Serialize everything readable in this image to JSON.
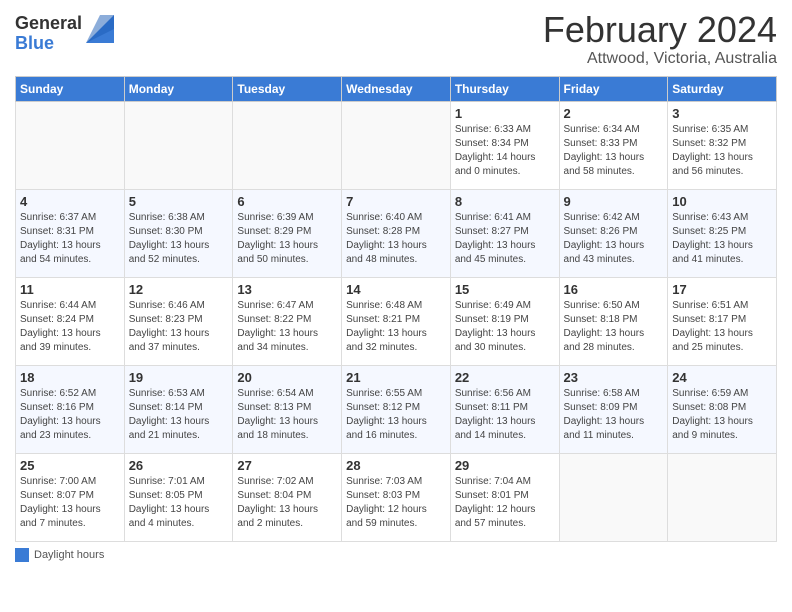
{
  "logo": {
    "general": "General",
    "blue": "Blue"
  },
  "title": "February 2024",
  "subtitle": "Attwood, Victoria, Australia",
  "days_of_week": [
    "Sunday",
    "Monday",
    "Tuesday",
    "Wednesday",
    "Thursday",
    "Friday",
    "Saturday"
  ],
  "weeks": [
    [
      {
        "day": "",
        "info": ""
      },
      {
        "day": "",
        "info": ""
      },
      {
        "day": "",
        "info": ""
      },
      {
        "day": "",
        "info": ""
      },
      {
        "day": "1",
        "info": "Sunrise: 6:33 AM\nSunset: 8:34 PM\nDaylight: 14 hours\nand 0 minutes."
      },
      {
        "day": "2",
        "info": "Sunrise: 6:34 AM\nSunset: 8:33 PM\nDaylight: 13 hours\nand 58 minutes."
      },
      {
        "day": "3",
        "info": "Sunrise: 6:35 AM\nSunset: 8:32 PM\nDaylight: 13 hours\nand 56 minutes."
      }
    ],
    [
      {
        "day": "4",
        "info": "Sunrise: 6:37 AM\nSunset: 8:31 PM\nDaylight: 13 hours\nand 54 minutes."
      },
      {
        "day": "5",
        "info": "Sunrise: 6:38 AM\nSunset: 8:30 PM\nDaylight: 13 hours\nand 52 minutes."
      },
      {
        "day": "6",
        "info": "Sunrise: 6:39 AM\nSunset: 8:29 PM\nDaylight: 13 hours\nand 50 minutes."
      },
      {
        "day": "7",
        "info": "Sunrise: 6:40 AM\nSunset: 8:28 PM\nDaylight: 13 hours\nand 48 minutes."
      },
      {
        "day": "8",
        "info": "Sunrise: 6:41 AM\nSunset: 8:27 PM\nDaylight: 13 hours\nand 45 minutes."
      },
      {
        "day": "9",
        "info": "Sunrise: 6:42 AM\nSunset: 8:26 PM\nDaylight: 13 hours\nand 43 minutes."
      },
      {
        "day": "10",
        "info": "Sunrise: 6:43 AM\nSunset: 8:25 PM\nDaylight: 13 hours\nand 41 minutes."
      }
    ],
    [
      {
        "day": "11",
        "info": "Sunrise: 6:44 AM\nSunset: 8:24 PM\nDaylight: 13 hours\nand 39 minutes."
      },
      {
        "day": "12",
        "info": "Sunrise: 6:46 AM\nSunset: 8:23 PM\nDaylight: 13 hours\nand 37 minutes."
      },
      {
        "day": "13",
        "info": "Sunrise: 6:47 AM\nSunset: 8:22 PM\nDaylight: 13 hours\nand 34 minutes."
      },
      {
        "day": "14",
        "info": "Sunrise: 6:48 AM\nSunset: 8:21 PM\nDaylight: 13 hours\nand 32 minutes."
      },
      {
        "day": "15",
        "info": "Sunrise: 6:49 AM\nSunset: 8:19 PM\nDaylight: 13 hours\nand 30 minutes."
      },
      {
        "day": "16",
        "info": "Sunrise: 6:50 AM\nSunset: 8:18 PM\nDaylight: 13 hours\nand 28 minutes."
      },
      {
        "day": "17",
        "info": "Sunrise: 6:51 AM\nSunset: 8:17 PM\nDaylight: 13 hours\nand 25 minutes."
      }
    ],
    [
      {
        "day": "18",
        "info": "Sunrise: 6:52 AM\nSunset: 8:16 PM\nDaylight: 13 hours\nand 23 minutes."
      },
      {
        "day": "19",
        "info": "Sunrise: 6:53 AM\nSunset: 8:14 PM\nDaylight: 13 hours\nand 21 minutes."
      },
      {
        "day": "20",
        "info": "Sunrise: 6:54 AM\nSunset: 8:13 PM\nDaylight: 13 hours\nand 18 minutes."
      },
      {
        "day": "21",
        "info": "Sunrise: 6:55 AM\nSunset: 8:12 PM\nDaylight: 13 hours\nand 16 minutes."
      },
      {
        "day": "22",
        "info": "Sunrise: 6:56 AM\nSunset: 8:11 PM\nDaylight: 13 hours\nand 14 minutes."
      },
      {
        "day": "23",
        "info": "Sunrise: 6:58 AM\nSunset: 8:09 PM\nDaylight: 13 hours\nand 11 minutes."
      },
      {
        "day": "24",
        "info": "Sunrise: 6:59 AM\nSunset: 8:08 PM\nDaylight: 13 hours\nand 9 minutes."
      }
    ],
    [
      {
        "day": "25",
        "info": "Sunrise: 7:00 AM\nSunset: 8:07 PM\nDaylight: 13 hours\nand 7 minutes."
      },
      {
        "day": "26",
        "info": "Sunrise: 7:01 AM\nSunset: 8:05 PM\nDaylight: 13 hours\nand 4 minutes."
      },
      {
        "day": "27",
        "info": "Sunrise: 7:02 AM\nSunset: 8:04 PM\nDaylight: 13 hours\nand 2 minutes."
      },
      {
        "day": "28",
        "info": "Sunrise: 7:03 AM\nSunset: 8:03 PM\nDaylight: 12 hours\nand 59 minutes."
      },
      {
        "day": "29",
        "info": "Sunrise: 7:04 AM\nSunset: 8:01 PM\nDaylight: 12 hours\nand 57 minutes."
      },
      {
        "day": "",
        "info": ""
      },
      {
        "day": "",
        "info": ""
      }
    ]
  ],
  "legend": {
    "label": "Daylight hours"
  }
}
